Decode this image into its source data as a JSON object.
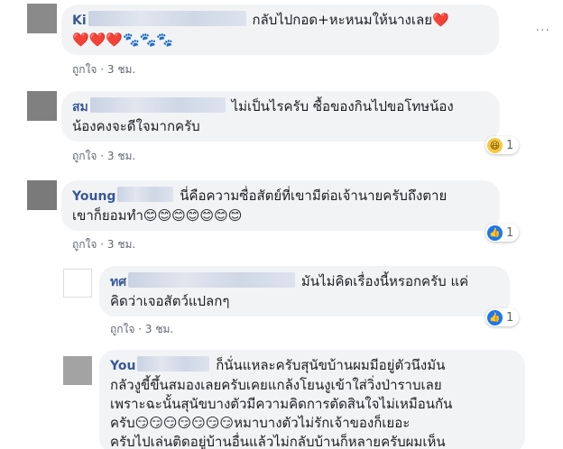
{
  "comments": [
    {
      "name_visible": "Ki",
      "text_line1": "กลับไปกอด+หะหนมให้นางเลย❤️",
      "text_line2": "❤️❤️❤️🐾🐾🐾",
      "like_label": "ถูกใจ",
      "time": "3 ชม.",
      "more": "···"
    },
    {
      "name_visible": "สม",
      "text_line1": "ไม่เป็นไรครับ ซื้อของกินไปขอโทษน้อง",
      "text_line2": "น้องคงจะดีใจมากครับ",
      "like_label": "ถูกใจ",
      "time": "3 ชม.",
      "reaction_icon": "haha-emoji-icon",
      "reaction_count": "1"
    },
    {
      "name_visible": "Young",
      "text_line1": "นี่คือความซื่อสัตย์ที่เขามีต่อเจ้านายครับถึงตาย",
      "text_line2": "เขาก็ยอมทำ😊😊😊😊😊😊😊",
      "like_label": "ถูกใจ",
      "time": "3 ชม.",
      "reaction_icon": "thumbs-up-icon",
      "reaction_count": "1"
    },
    {
      "name_visible": "ทศ",
      "text_line1": "มันไม่คิดเรื่องนี้หรอกครับ แค่",
      "text_line2": "คิดว่าเจอสัตว์แปลกๆ",
      "like_label": "ถูกใจ",
      "time": "3 ชม.",
      "reaction_icon": "thumbs-up-icon",
      "reaction_count": "1"
    },
    {
      "name_visible": "You",
      "text_line1": "ก็นั่นแหละครับสุนัขบ้านผมมีอยู่ตัวนึงมัน",
      "text_line2": "กลัวงูขี้ขึ้นสมองเลยครับเคยแกล้งโยนงูเข้าใส่วิ่งป่าราบเลย",
      "text_line3": "เพราะฉะนั้นสุนัขบางตัวมีความคิดการตัดสินใจไม่เหมือนกัน",
      "text_line4": "ครับ😏😏😏😏😏😏😏หมาบางตัวไม่รักเจ้าของก็เยอะ",
      "text_line5": "ครับไปเล่นติดอยู่บ้านอื่นแล้วไม่กลับบ้านก็หลายครับผมเห็น"
    }
  ]
}
